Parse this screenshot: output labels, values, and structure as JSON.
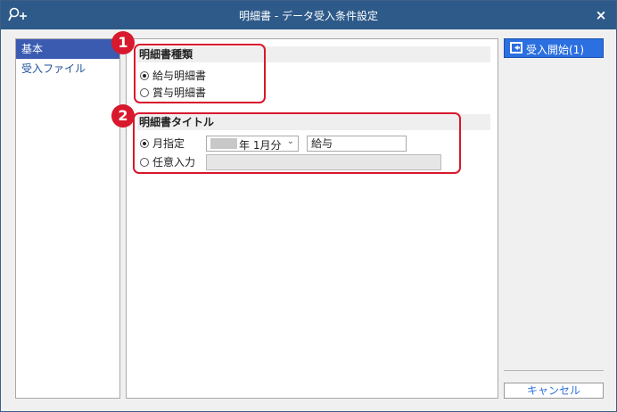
{
  "window": {
    "title": "明細書 - データ受入条件設定",
    "close_label": "×",
    "app_icon": "key-plus-icon"
  },
  "sidebar": {
    "items": [
      {
        "label": "基本",
        "active": true
      },
      {
        "label": "受入ファイル",
        "active": false
      }
    ]
  },
  "sections": {
    "type": {
      "header": "明細書種類",
      "options": [
        {
          "label": "給与明細書",
          "checked": true
        },
        {
          "label": "賞与明細書",
          "checked": false
        }
      ]
    },
    "title": {
      "header": "明細書タイトル",
      "month_option": {
        "label": "月指定",
        "checked": true
      },
      "month_select": {
        "value": "年 1月分",
        "chevron": "⌄"
      },
      "month_text": {
        "value": "給与"
      },
      "free_option": {
        "label": "任意入力",
        "checked": false
      },
      "free_text": {
        "value": ""
      }
    }
  },
  "callouts": [
    {
      "number": "1"
    },
    {
      "number": "2"
    }
  ],
  "actions": {
    "start_label": "受入開始(1)",
    "start_icon": "import-icon",
    "cancel_label": "キャンセル"
  },
  "colors": {
    "titlebar": "#2e5a8a",
    "accent": "#2b6fe0",
    "callout": "#d8182c",
    "sidebar_active": "#3a5bb0"
  }
}
